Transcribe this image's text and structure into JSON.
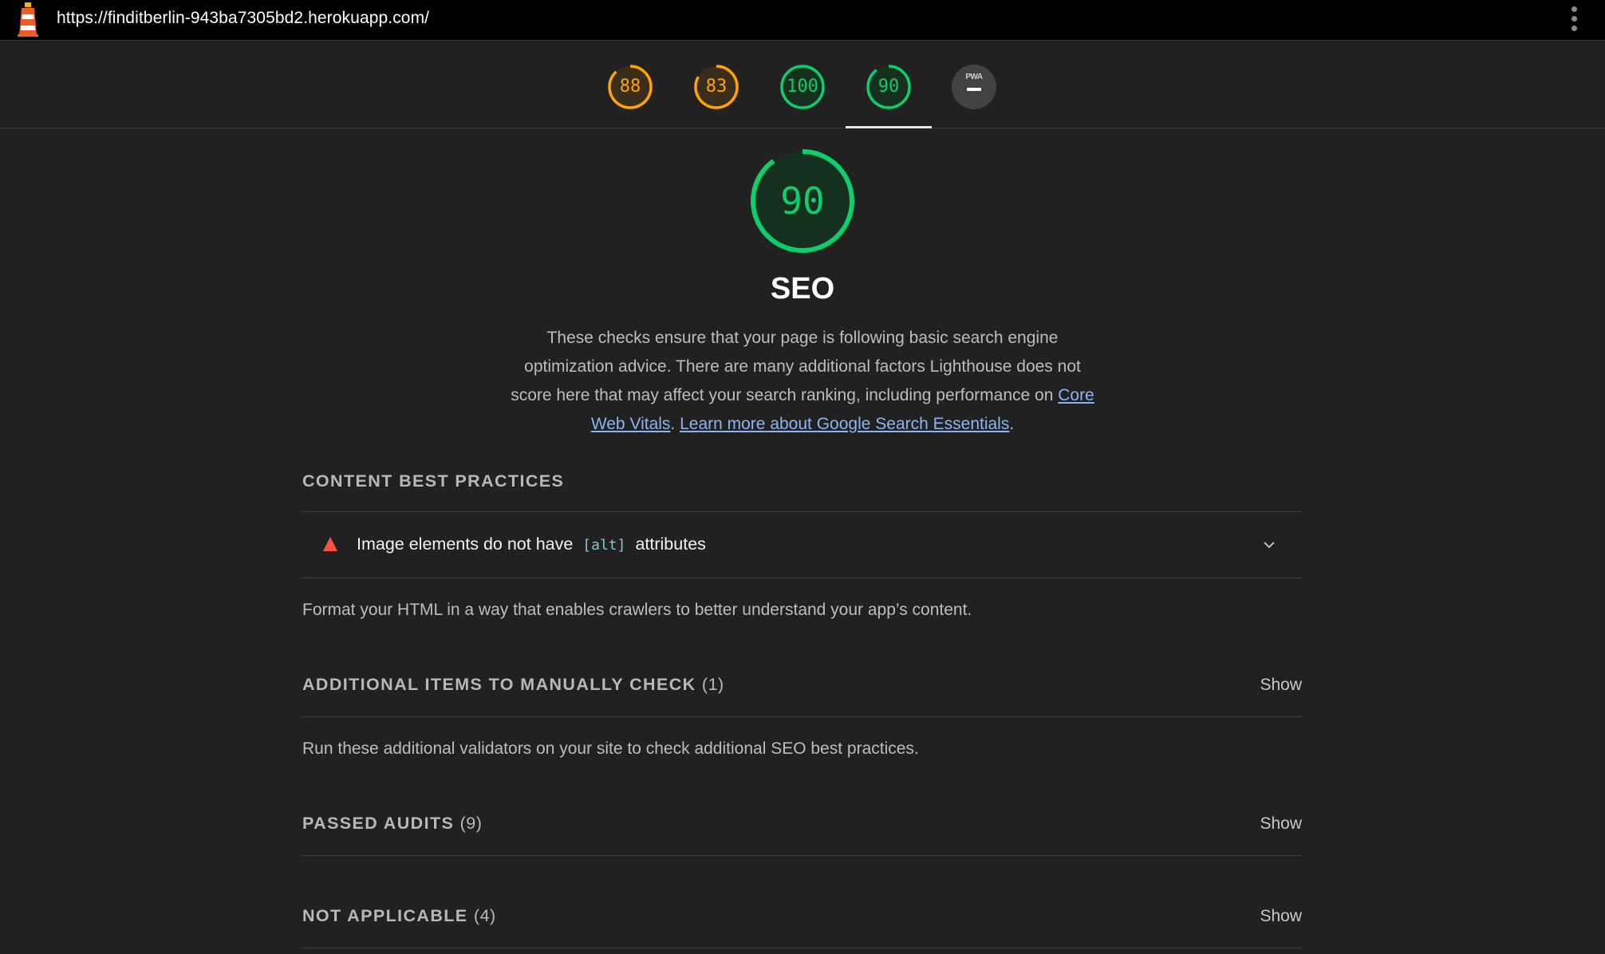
{
  "browser": {
    "url": "https://finditberlin-943ba7305bd2.herokuapp.com/",
    "logo_icon": "lighthouse-icon",
    "menu_icon": "kebab-menu-icon"
  },
  "score_nav": [
    {
      "score": "88",
      "level": 0.88,
      "color": "#ffa400"
    },
    {
      "score": "83",
      "level": 0.83,
      "color": "#ffa400"
    },
    {
      "score": "100",
      "level": 1.0,
      "color": "#0cce6b"
    },
    {
      "score": "90",
      "level": 0.9,
      "color": "#0cce6b",
      "active": true
    },
    {
      "label": "PWA",
      "icon": "dash-icon"
    }
  ],
  "category": {
    "score": "90",
    "level": 0.9,
    "title": "SEO",
    "description_1": "These checks ensure that your page is following basic search engine optimization advice. There are many additional factors Lighthouse does not score here that may affect your search ranking, including performance on ",
    "link_1": "Core Web Vitals",
    "separator": ". ",
    "link_2": "Learn more about Google Search Essentials",
    "end": "."
  },
  "groups": {
    "content_best_practices": {
      "title": "CONTENT BEST PRACTICES",
      "audit": {
        "title_before": "Image elements do not have",
        "code": "[alt]",
        "title_after": "attributes"
      },
      "description": "Format your HTML in a way that enables crawlers to better understand your app’s content."
    },
    "manual": {
      "title": "ADDITIONAL ITEMS TO MANUALLY CHECK",
      "count": "(1)",
      "show": "Show",
      "description": "Run these additional validators on your site to check additional SEO best practices."
    },
    "passed": {
      "title": "PASSED AUDITS",
      "count": "(9)",
      "show": "Show"
    },
    "not_applicable": {
      "title": "NOT APPLICABLE",
      "count": "(4)",
      "show": "Show"
    }
  },
  "colors": {
    "pass": "#0cce6b",
    "average": "#ffa400",
    "fail": "#ff4e42",
    "link": "#8ab4f8"
  }
}
